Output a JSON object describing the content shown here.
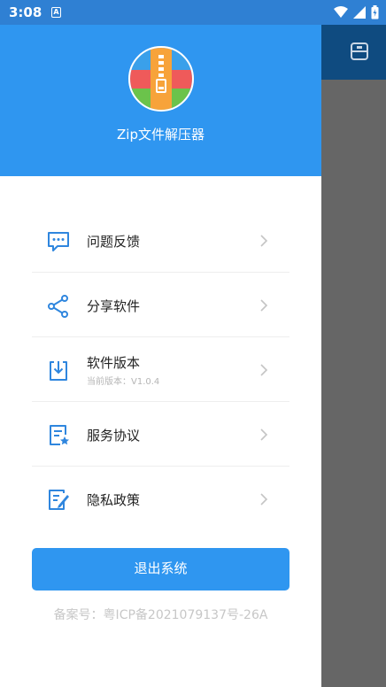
{
  "status_bar": {
    "time": "3:08",
    "notification_letter": "A"
  },
  "header": {
    "app_name": "Zip文件解压器"
  },
  "menu": {
    "items": [
      {
        "label": "问题反馈",
        "icon": "feedback-icon"
      },
      {
        "label": "分享软件",
        "icon": "share-icon"
      },
      {
        "label": "软件版本",
        "sublabel": "当前版本：V1.0.4",
        "icon": "version-icon"
      },
      {
        "label": "服务协议",
        "icon": "service-agreement-icon"
      },
      {
        "label": "隐私政策",
        "icon": "privacy-policy-icon"
      }
    ]
  },
  "logout_label": "退出系统",
  "icp_text": "备案号：粤ICP备2021079137号-26A",
  "colors": {
    "primary": "#2f96f0",
    "background_toolbar": "#0f4b80"
  }
}
